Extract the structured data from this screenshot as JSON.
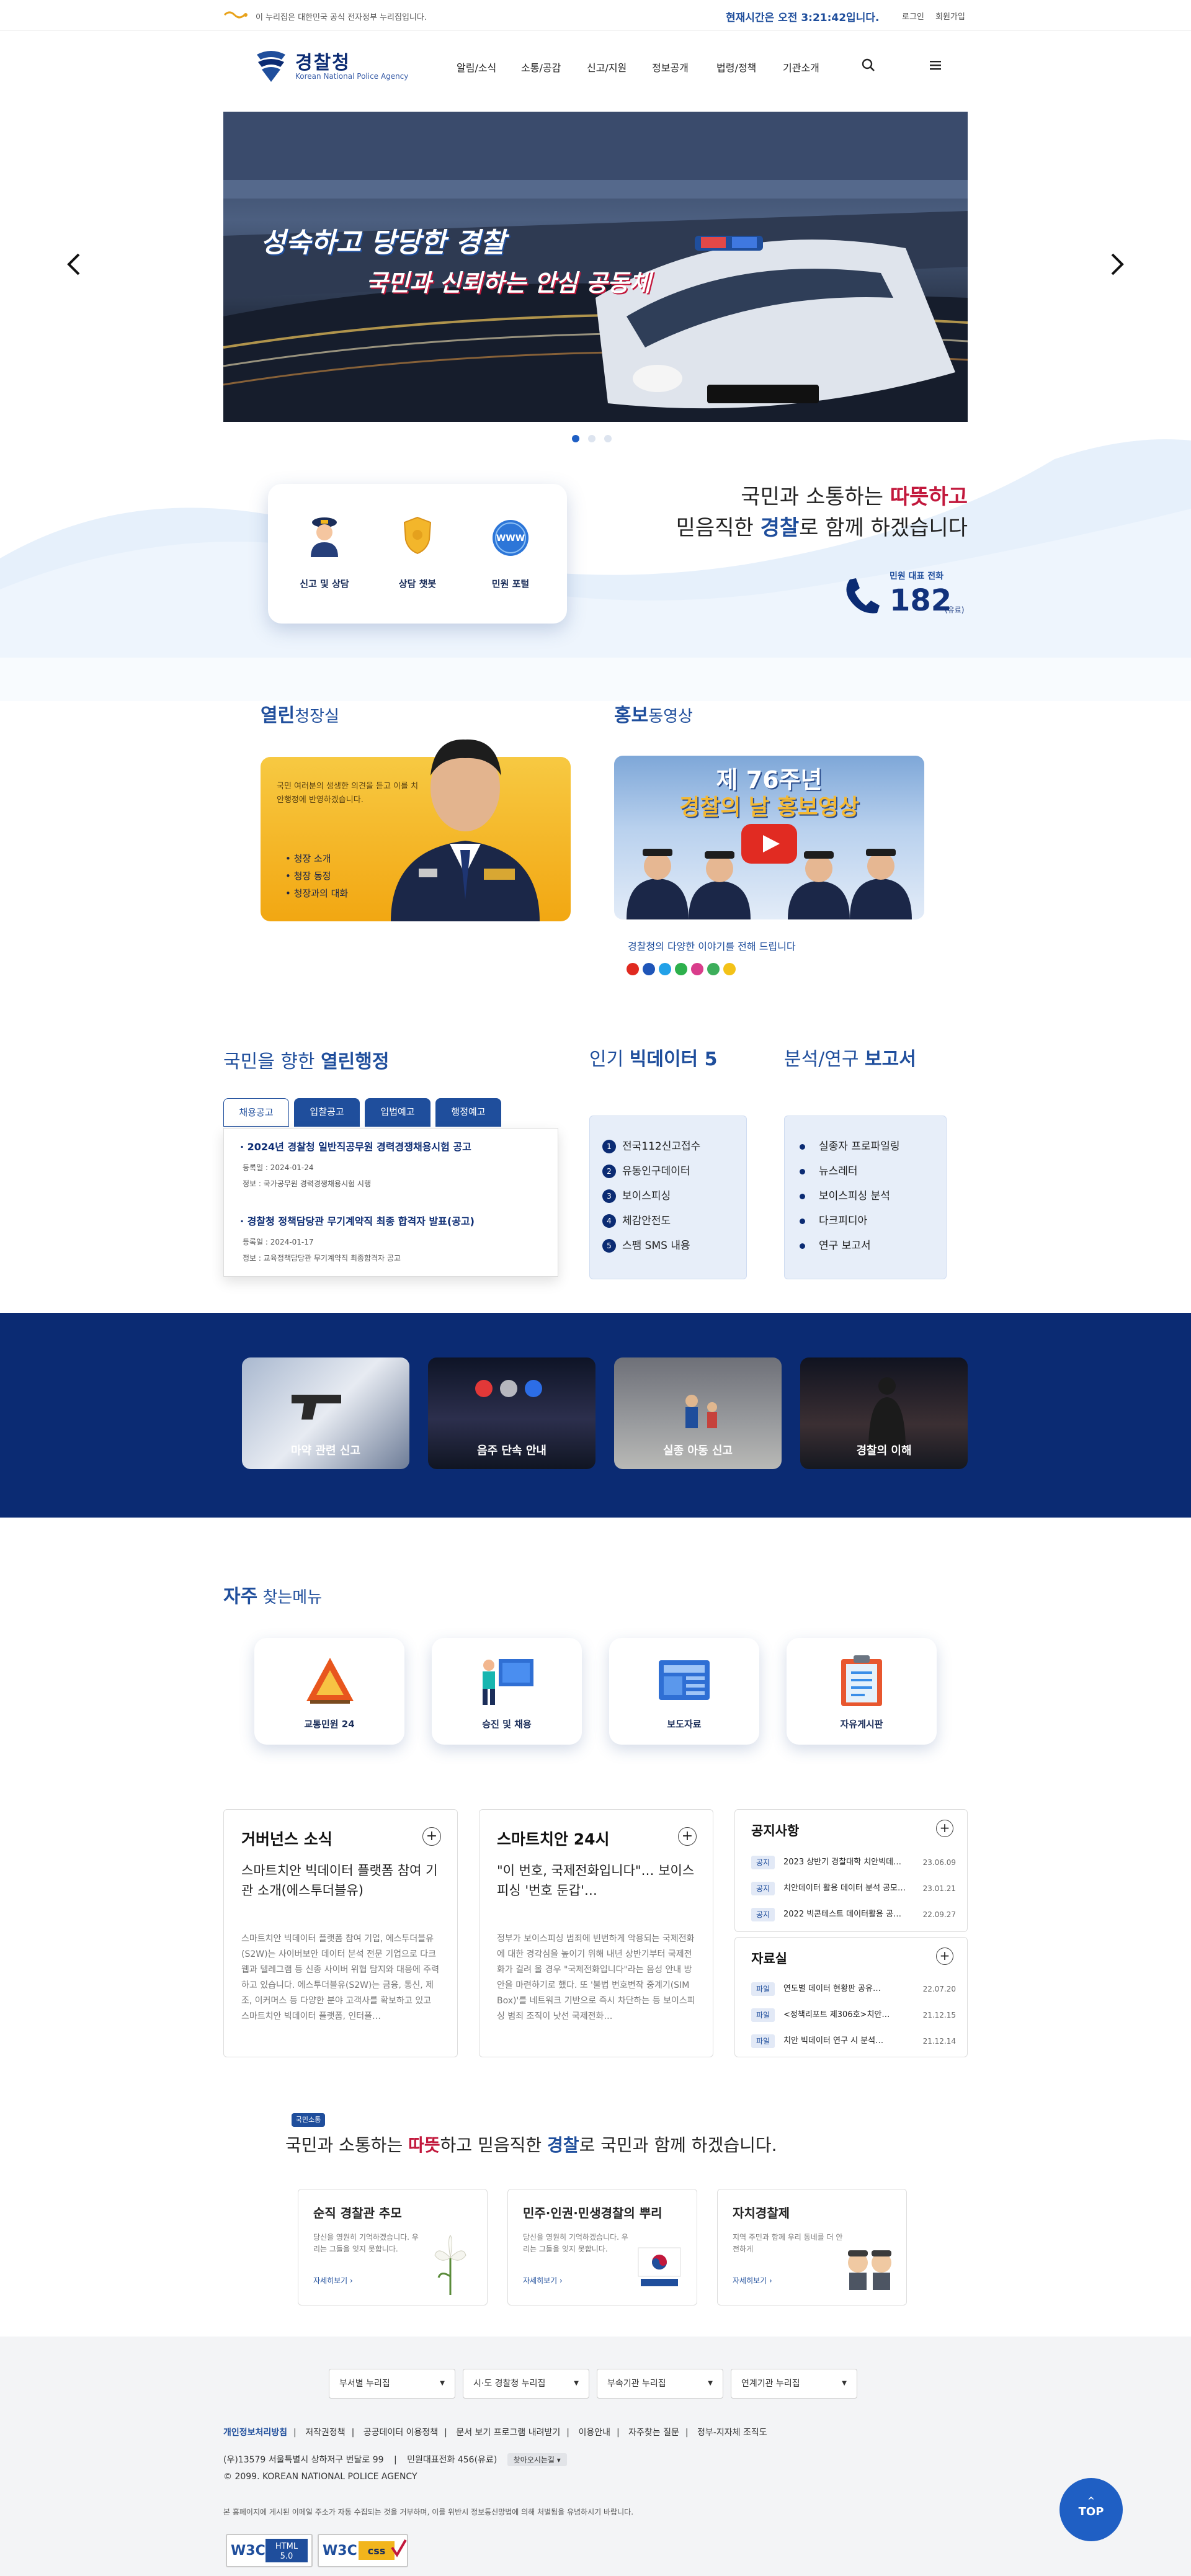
{
  "topbar": {
    "gov_notice": "이 누리집은 대한민국 공식 전자정부 누리집입니다.",
    "clock": "현재시간은 오전 3:21:42입니다.",
    "login": "로그인",
    "signup": "회원가입"
  },
  "header": {
    "logo_title": "경찰청",
    "logo_sub": "Korean National Police Agency",
    "nav": [
      "알림/소식",
      "소통/공감",
      "신고/지원",
      "정보공개",
      "법령/정책",
      "기관소개"
    ],
    "search_icon": "search-icon",
    "menu_icon": "menu-icon"
  },
  "hero": {
    "headline_1": "성숙하고 당당한 경찰",
    "headline_2": "국민과 신뢰하는 안심 공동체",
    "prev_icon": "chevron-left-icon",
    "next_icon": "chevron-right-icon",
    "slide_count": 3,
    "active_slide": 1
  },
  "services": {
    "items": [
      {
        "label": "신고 및 상담",
        "icon": "police-officer-icon"
      },
      {
        "label": "상담 챗봇",
        "icon": "police-badge-icon"
      },
      {
        "label": "민원 포털",
        "icon": "www-globe-icon"
      }
    ]
  },
  "slogan": {
    "line1_a": "국민과 소통하는 ",
    "line1_red": "따뜻하고",
    "line2_a": "믿음직한 ",
    "line2_blue": "경찰",
    "line2_b": "로 함께 하겠습니다",
    "phone_label": "민원 대표 전화",
    "phone_number": "182",
    "phone_note": "(유료)"
  },
  "chief": {
    "title_bold": "열린",
    "title_rest": "청장실",
    "description": "국민 여러분의 생생한 의견을 듣고 이를 치안행정에 반영하겠습니다.",
    "links": [
      "청장 소개",
      "청장 동정",
      "청장과의 대화"
    ]
  },
  "pr_video": {
    "title_bold": "홍보",
    "title_rest": "동영상",
    "video_title_1": "제 76주년",
    "video_title_2": "경찰의 날 홍보영상",
    "caption": "경찰청의 다양한 이야기를 전해 드립니다",
    "sns": [
      {
        "icon": "youtube-icon",
        "color": "#e02a20"
      },
      {
        "icon": "facebook-icon",
        "color": "#1f55b8"
      },
      {
        "icon": "twitter-icon",
        "color": "#22a1e8"
      },
      {
        "icon": "blog-icon",
        "color": "#2db04c"
      },
      {
        "icon": "instagram-icon",
        "color": "#d93d8b"
      },
      {
        "icon": "kakao-story-icon",
        "color": "#3dae5b"
      },
      {
        "icon": "kakao-icon",
        "color": "#f3c218"
      }
    ]
  },
  "open_admin": {
    "title_a": "국민을 향한 ",
    "title_bold": "열린행정",
    "tabs": [
      "채용공고",
      "입찰공고",
      "입법예고",
      "행정예고"
    ],
    "active_tab": 0,
    "notices": [
      {
        "title": "· 2024년 경찰청 일반직공무원 경력경쟁채용시험 공고",
        "date": "등록일 : 2024-01-24",
        "dept": "정보 : 국가공무원 경력경쟁채용시험 시행"
      },
      {
        "title": "· 경찰청 정책담당관 무기계약직 최종 합격자 발표(공고)",
        "date": "등록일 : 2024-01-17",
        "dept": "정보 : 교육정책담당관 무기계약직 최종합격자 공고"
      }
    ]
  },
  "bigdata": {
    "title_a": "인기 ",
    "title_bold": "빅데이터 5",
    "items": [
      "전국112신고접수",
      "유동인구데이터",
      "보이스피싱",
      "체감안전도",
      "스팸 SMS 내용"
    ]
  },
  "reports": {
    "title_a": "분석/연구 ",
    "title_bold": "보고서",
    "items": [
      "실종자 프로파일링",
      "뉴스레터",
      "보이스피싱 분석",
      "다크피디아",
      "연구 보고서"
    ]
  },
  "band": {
    "cards": [
      "마약 관련 신고",
      "음주 단속 안내",
      "실종 아동 신고",
      "경찰의 이해"
    ]
  },
  "frequent": {
    "title_bold": "자주",
    "title_rest": " 찾는메뉴",
    "items": [
      {
        "label": "교통민원 24",
        "icon": "warning-triangle-icon"
      },
      {
        "label": "승진 및 채용",
        "icon": "presentation-board-icon"
      },
      {
        "label": "보도자료",
        "icon": "newspaper-icon"
      },
      {
        "label": "자유게시판",
        "icon": "clipboard-icon"
      }
    ]
  },
  "governance": {
    "title": "거버넌스 소식",
    "subtitle": "스마트치안 빅데이터 플랫폼 참여 기관 소개(에스투더블유)",
    "body": "스마트치안 빅데이터 플랫폼 참여 기업, 에스투더블유(S2W)는 사이버보안 데이터 분석 전문 기업으로 다크웹과 텔레그램 등 신종 사이버 위협 탐지와 대응에 주력하고 있습니다. 에스투더블유(S2W)는 금융, 통신, 제조, 이커머스 등 다양한 분야 고객사를 확보하고 있고 스마트치안 빅데이터 플랫폼, 인터폴…"
  },
  "smart": {
    "title": "스마트치안 24시",
    "subtitle": "\"이 번호, 국제전화입니다\"… 보이스피싱 '번호 둔갑'…",
    "body": "정부가 보이스피싱 범죄에 빈번하게 악용되는 국제전화에 대한 경각심을 높이기 위해 내년 상반기부터 국제전화가 걸려 올 경우 \"국제전화입니다\"라는 음성 안내 방안을 마련하기로 했다. 또 '불법 번호변작 중계기(SIM Box)'를 네트워크 기반으로 즉시 차단하는 등 보이스피싱 범죄 조직이 낫선 국제전화…"
  },
  "notice_board": {
    "title": "공지사항",
    "rows": [
      {
        "tag": "공지",
        "title": "2023 상반기 경찰대학 치안빅데이터…",
        "date": "23.06.09"
      },
      {
        "tag": "공지",
        "title": "치안데이터 활용 데이터 분석 공모전…",
        "date": "23.01.21"
      },
      {
        "tag": "공지",
        "title": "2022 빅콘테스트 데이터활용 공모전…",
        "date": "22.09.27"
      }
    ]
  },
  "data_room": {
    "title": "자료실",
    "rows": [
      {
        "tag": "파일",
        "title": "연도별 데이터 현황판 공유…",
        "date": "22.07.20"
      },
      {
        "tag": "파일",
        "title": "<정책리포트 제306호>치안…",
        "date": "21.12.15"
      },
      {
        "tag": "파일",
        "title": "치안 빅데이터 연구 시 분석…",
        "date": "21.12.14"
      }
    ]
  },
  "campaign": {
    "badge": "국민소통",
    "title_a": "국민과 소통하는 ",
    "title_red": "따뜻",
    "title_b": "하고 믿음직한 ",
    "title_blue": "경찰",
    "title_c": "로 국민과 함께 하겠습니다.",
    "cards": [
      {
        "title": "순직 경찰관 추모",
        "desc": "당신을 영원히 기억하겠습니다. 우리는 그들을 잊지 못합니다.",
        "more": "자세히보기",
        "icon": "white-lily-icon"
      },
      {
        "title": "민주·인권·민생경찰의 뿌리",
        "desc": "당신을 영원히 기억하겠습니다. 우리는 그들을 잊지 못합니다.",
        "more": "자세히보기",
        "icon": "taegukgi-icon"
      },
      {
        "title": "자치경찰제",
        "desc": "지역 주민과 함께 우리 동네를 더 안전하게",
        "more": "자세히보기",
        "icon": "police-characters-icon"
      }
    ]
  },
  "footer": {
    "selects": [
      "부서별 누리집",
      "시·도 경찰청 누리집",
      "부속기관 누리집",
      "연계기관 누리집"
    ],
    "links": [
      "개인정보처리방침",
      "저작권정책",
      "공공데이터 이용정책",
      "문서 보기 프로그램 내려받기",
      "이용안내",
      "자주찾는 질문",
      "정부-지자체 조직도"
    ],
    "address": "(우)13579 서울특별시 상하저구 번달로 99",
    "phone": "민원대표전화 456(유료)",
    "directions": "찾아오시는길",
    "copyright": "© 2099. KOREAN NATIONAL POLICE AGENCY",
    "notice": "본 홈페이지에 게시된 이메일 주소가 자동 수집되는 것을 거부하며, 이를 위반시 정보통신망법에 의해 처벌됨을 유념하시기 바랍니다.",
    "badge_html": "W3C HTML 5.0",
    "badge_css": "W3C CSS",
    "top_button": "TOP"
  },
  "colors": {
    "brand_navy": "#0b2b73",
    "brand_blue": "#1f4e9c",
    "accent_red": "#c2183c",
    "light_blue": "#e7eef9"
  }
}
